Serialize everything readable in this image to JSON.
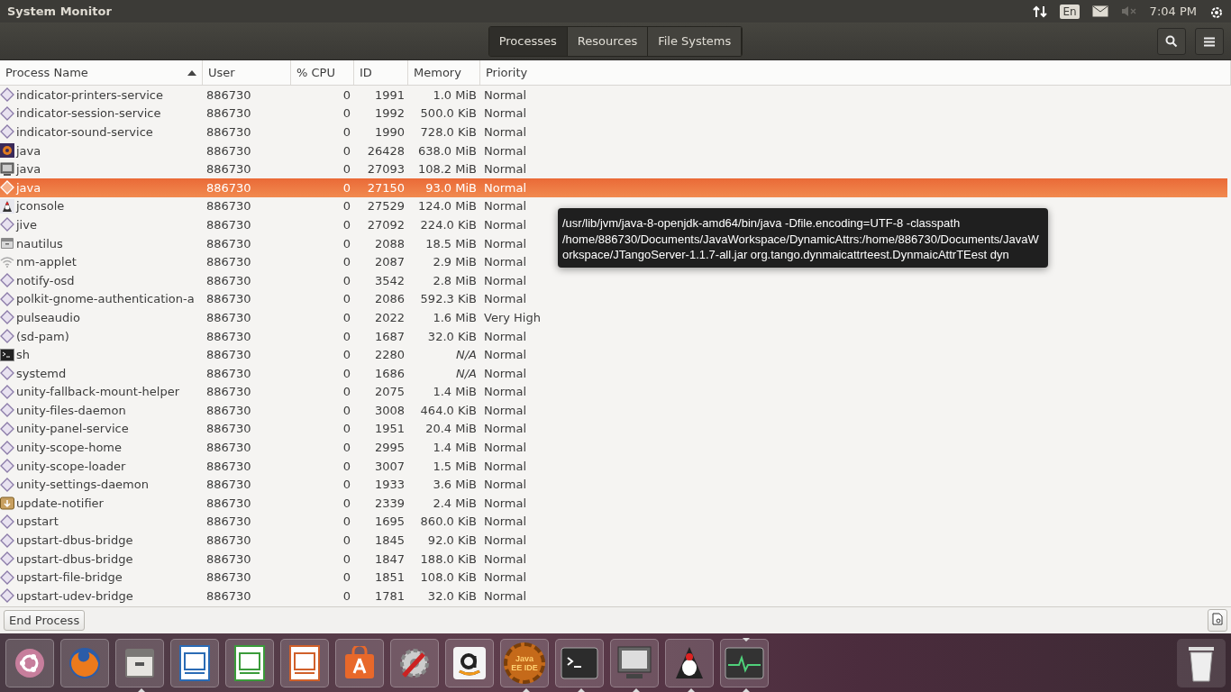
{
  "top_panel": {
    "title": "System Monitor",
    "keyboard": "En",
    "time": "7:04 PM"
  },
  "tabs": [
    {
      "label": "Processes",
      "selected": true
    },
    {
      "label": "Resources",
      "selected": false
    },
    {
      "label": "File Systems",
      "selected": false
    }
  ],
  "table": {
    "columns": [
      {
        "label": "Process Name",
        "sorted": true
      },
      {
        "label": "User",
        "sorted": false
      },
      {
        "label": "% CPU",
        "sorted": false
      },
      {
        "label": "ID",
        "sorted": false
      },
      {
        "label": "Memory",
        "sorted": false
      },
      {
        "label": "Priority",
        "sorted": false
      }
    ],
    "rows": [
      {
        "kind": "diamond",
        "name": "indicator-printers-service",
        "user": "886730",
        "cpu": "0",
        "id": "1991",
        "memory": "1.0 MiB",
        "priority": "Normal",
        "selected": false
      },
      {
        "kind": "diamond",
        "name": "indicator-session-service",
        "user": "886730",
        "cpu": "0",
        "id": "1992",
        "memory": "500.0 KiB",
        "priority": "Normal",
        "selected": false
      },
      {
        "kind": "diamond",
        "name": "indicator-sound-service",
        "user": "886730",
        "cpu": "0",
        "id": "1990",
        "memory": "728.0 KiB",
        "priority": "Normal",
        "selected": false
      },
      {
        "kind": "gear",
        "name": "java",
        "user": "886730",
        "cpu": "0",
        "id": "26428",
        "memory": "638.0 MiB",
        "priority": "Normal",
        "selected": false
      },
      {
        "kind": "computer",
        "name": "java",
        "user": "886730",
        "cpu": "0",
        "id": "27093",
        "memory": "108.2 MiB",
        "priority": "Normal",
        "selected": false
      },
      {
        "kind": "diamond",
        "name": "java",
        "user": "886730",
        "cpu": "0",
        "id": "27150",
        "memory": "93.0 MiB",
        "priority": "Normal",
        "selected": true
      },
      {
        "kind": "mascot",
        "name": "jconsole",
        "user": "886730",
        "cpu": "0",
        "id": "27529",
        "memory": "124.0 MiB",
        "priority": "Normal",
        "selected": false
      },
      {
        "kind": "diamond",
        "name": "jive",
        "user": "886730",
        "cpu": "0",
        "id": "27092",
        "memory": "224.0 KiB",
        "priority": "Normal",
        "selected": false
      },
      {
        "kind": "cabinet",
        "name": "nautilus",
        "user": "886730",
        "cpu": "0",
        "id": "2088",
        "memory": "18.5 MiB",
        "priority": "Normal",
        "selected": false
      },
      {
        "kind": "wifi",
        "name": "nm-applet",
        "user": "886730",
        "cpu": "0",
        "id": "2087",
        "memory": "2.9 MiB",
        "priority": "Normal",
        "selected": false
      },
      {
        "kind": "diamond",
        "name": "notify-osd",
        "user": "886730",
        "cpu": "0",
        "id": "3542",
        "memory": "2.8 MiB",
        "priority": "Normal",
        "selected": false
      },
      {
        "kind": "diamond",
        "name": "polkit-gnome-authentication-a",
        "user": "886730",
        "cpu": "0",
        "id": "2086",
        "memory": "592.3 KiB",
        "priority": "Normal",
        "selected": false
      },
      {
        "kind": "diamond",
        "name": "pulseaudio",
        "user": "886730",
        "cpu": "0",
        "id": "2022",
        "memory": "1.6 MiB",
        "priority": "Very High",
        "selected": false
      },
      {
        "kind": "diamond",
        "name": "(sd-pam)",
        "user": "886730",
        "cpu": "0",
        "id": "1687",
        "memory": "32.0 KiB",
        "priority": "Normal",
        "selected": false
      },
      {
        "kind": "terminal",
        "name": "sh",
        "user": "886730",
        "cpu": "0",
        "id": "2280",
        "memory": "N/A",
        "priority": "Normal",
        "selected": false
      },
      {
        "kind": "diamond",
        "name": "systemd",
        "user": "886730",
        "cpu": "0",
        "id": "1686",
        "memory": "N/A",
        "priority": "Normal",
        "selected": false
      },
      {
        "kind": "diamond",
        "name": "unity-fallback-mount-helper",
        "user": "886730",
        "cpu": "0",
        "id": "2075",
        "memory": "1.4 MiB",
        "priority": "Normal",
        "selected": false
      },
      {
        "kind": "diamond",
        "name": "unity-files-daemon",
        "user": "886730",
        "cpu": "0",
        "id": "3008",
        "memory": "464.0 KiB",
        "priority": "Normal",
        "selected": false
      },
      {
        "kind": "diamond",
        "name": "unity-panel-service",
        "user": "886730",
        "cpu": "0",
        "id": "1951",
        "memory": "20.4 MiB",
        "priority": "Normal",
        "selected": false
      },
      {
        "kind": "diamond",
        "name": "unity-scope-home",
        "user": "886730",
        "cpu": "0",
        "id": "2995",
        "memory": "1.4 MiB",
        "priority": "Normal",
        "selected": false
      },
      {
        "kind": "diamond",
        "name": "unity-scope-loader",
        "user": "886730",
        "cpu": "0",
        "id": "3007",
        "memory": "1.5 MiB",
        "priority": "Normal",
        "selected": false
      },
      {
        "kind": "diamond",
        "name": "unity-settings-daemon",
        "user": "886730",
        "cpu": "0",
        "id": "1933",
        "memory": "3.6 MiB",
        "priority": "Normal",
        "selected": false
      },
      {
        "kind": "package",
        "name": "update-notifier",
        "user": "886730",
        "cpu": "0",
        "id": "2339",
        "memory": "2.4 MiB",
        "priority": "Normal",
        "selected": false
      },
      {
        "kind": "diamond",
        "name": "upstart",
        "user": "886730",
        "cpu": "0",
        "id": "1695",
        "memory": "860.0 KiB",
        "priority": "Normal",
        "selected": false
      },
      {
        "kind": "diamond",
        "name": "upstart-dbus-bridge",
        "user": "886730",
        "cpu": "0",
        "id": "1845",
        "memory": "92.0 KiB",
        "priority": "Normal",
        "selected": false
      },
      {
        "kind": "diamond",
        "name": "upstart-dbus-bridge",
        "user": "886730",
        "cpu": "0",
        "id": "1847",
        "memory": "188.0 KiB",
        "priority": "Normal",
        "selected": false
      },
      {
        "kind": "diamond",
        "name": "upstart-file-bridge",
        "user": "886730",
        "cpu": "0",
        "id": "1851",
        "memory": "108.0 KiB",
        "priority": "Normal",
        "selected": false
      },
      {
        "kind": "diamond",
        "name": "upstart-udev-bridge",
        "user": "886730",
        "cpu": "0",
        "id": "1781",
        "memory": "32.0 KiB",
        "priority": "Normal",
        "selected": false
      }
    ]
  },
  "tooltip": "/usr/lib/jvm/java-8-openjdk-amd64/bin/java -Dfile.encoding=UTF-8 -classpath /home/886730/Documents/JavaWorkspace/DynamicAttrs:/home/886730/Documents/JavaWorkspace/JTangoServer-1.1.7-all.jar org.tango.dynmaicattrteest.DynmaicAttrTEest dyn",
  "end_process": "End Process",
  "dock": [
    {
      "kind": "ubuntu",
      "running": false,
      "focused": false
    },
    {
      "kind": "firefox",
      "running": false,
      "focused": false
    },
    {
      "kind": "files",
      "running": true,
      "focused": false
    },
    {
      "kind": "writer",
      "running": false,
      "focused": false
    },
    {
      "kind": "calc",
      "running": false,
      "focused": false
    },
    {
      "kind": "impress",
      "running": false,
      "focused": false
    },
    {
      "kind": "software",
      "running": false,
      "focused": false
    },
    {
      "kind": "settings",
      "running": false,
      "focused": false
    },
    {
      "kind": "amazon",
      "running": false,
      "focused": false
    },
    {
      "kind": "javaee",
      "label": "Java EE IDE",
      "running": true,
      "focused": false
    },
    {
      "kind": "terminal",
      "running": true,
      "focused": false
    },
    {
      "kind": "computer",
      "running": true,
      "focused": false
    },
    {
      "kind": "mascot",
      "running": true,
      "focused": false
    },
    {
      "kind": "monitor",
      "running": true,
      "focused": true
    }
  ]
}
